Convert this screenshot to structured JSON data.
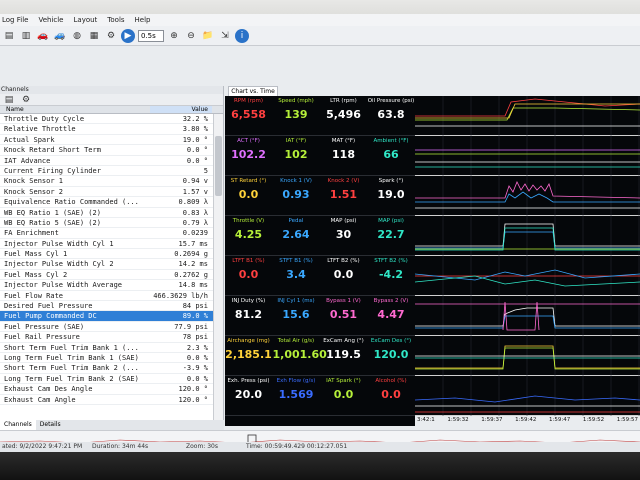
{
  "menu": [
    "Log File",
    "Vehicle",
    "Layout",
    "Tools",
    "Help"
  ],
  "toolbar": {
    "zoom_select": "0.5s"
  },
  "left_panel": {
    "title": "Channels",
    "columns": {
      "name": "Name",
      "value": "Value"
    },
    "rows": [
      {
        "name": "Throttle Duty Cycle",
        "value": "32.2 %"
      },
      {
        "name": "Relative Throttle",
        "value": "3.80 %"
      },
      {
        "name": "Actual Spark",
        "value": "19.0 °"
      },
      {
        "name": "Knock Retard Short Term",
        "value": "0.0 °"
      },
      {
        "name": "IAT Advance",
        "value": "0.0 °"
      },
      {
        "name": "Current Firing Cylinder",
        "value": "5"
      },
      {
        "name": "Knock Sensor 1",
        "value": "0.94 v"
      },
      {
        "name": "Knock Sensor 2",
        "value": "1.57 v"
      },
      {
        "name": "Equivalence Ratio Commanded (...",
        "value": "0.809 λ"
      },
      {
        "name": "WB EQ Ratio 1 (SAE) (2)",
        "value": "0.83 λ"
      },
      {
        "name": "WB EQ Ratio 5 (SAE) (2)",
        "value": "0.79 λ"
      },
      {
        "name": "FA Enrichment",
        "value": "0.0239"
      },
      {
        "name": "Injector Pulse Width Cyl 1",
        "value": "15.7 ms"
      },
      {
        "name": "Fuel Mass Cyl 1",
        "value": "0.2694 g"
      },
      {
        "name": "Injector Pulse Width Cyl 2",
        "value": "14.2 ms"
      },
      {
        "name": "Fuel Mass Cyl 2",
        "value": "0.2762 g"
      },
      {
        "name": "Injector Pulse Width Average",
        "value": "14.8 ms"
      },
      {
        "name": "Fuel Flow Rate",
        "value": "466.3629 lb/h"
      },
      {
        "name": "Desired Fuel Pressure",
        "value": "84 psi"
      },
      {
        "name": "Fuel Pump Commanded DC",
        "value": "89.0 %",
        "selected": true
      },
      {
        "name": "Fuel Pressure (SAE)",
        "value": "77.9 psi"
      },
      {
        "name": "Fuel Rail Pressure",
        "value": "78 psi"
      },
      {
        "name": "Short Term Fuel Trim Bank 1 (...",
        "value": "2.3 %"
      },
      {
        "name": "Long Term Fuel Trim Bank 1 (SAE)",
        "value": "0.0 %"
      },
      {
        "name": "Short Term Fuel Trim Bank 2 (...",
        "value": "-3.9 %"
      },
      {
        "name": "Long Term Fuel Trim Bank 2 (SAE)",
        "value": "0.0 %"
      },
      {
        "name": "Exhaust Cam Des Angle",
        "value": "120.0 °"
      },
      {
        "name": "Exhaust Cam Angle",
        "value": "120.0 °"
      }
    ],
    "tabs": [
      "Channels",
      "Details"
    ]
  },
  "chart_tab": "Chart vs. Time",
  "gauges": [
    [
      {
        "label": "RPM (rpm)",
        "value": "6,558",
        "color": "#ff4040"
      },
      {
        "label": "Speed (mph)",
        "value": "139",
        "color": "#b6f03a"
      },
      {
        "label": "LTR (rpm)",
        "value": "5,496",
        "color": "#ffffff"
      },
      {
        "label": "Oil Pressure (psi)",
        "value": "63.8",
        "color": "#ffffff"
      }
    ],
    [
      {
        "label": "ACT (°F)",
        "value": "102.2",
        "color": "#e070ff"
      },
      {
        "label": "IAT (°F)",
        "value": "102",
        "color": "#b6f03a"
      },
      {
        "label": "MAT (°F)",
        "value": "118",
        "color": "#ffffff"
      },
      {
        "label": "Ambient (°F)",
        "value": "66",
        "color": "#30e8c8"
      }
    ],
    [
      {
        "label": "ST Retard (°)",
        "value": "0.0",
        "color": "#ffd23a"
      },
      {
        "label": "Knock 1 (V)",
        "value": "0.93",
        "color": "#3aa8ff"
      },
      {
        "label": "Knock 2 (V)",
        "value": "1.51",
        "color": "#ff4040"
      },
      {
        "label": "Spark (°)",
        "value": "19.0",
        "color": "#ffffff"
      }
    ],
    [
      {
        "label": "Throttle (V)",
        "value": "4.25",
        "color": "#b6f03a"
      },
      {
        "label": "Pedal",
        "value": "2.64",
        "color": "#3aa8ff"
      },
      {
        "label": "MAP (psi)",
        "value": "30",
        "color": "#ffffff"
      },
      {
        "label": "MAP (psi)",
        "value": "22.7",
        "color": "#30e8c8"
      }
    ],
    [
      {
        "label": "LTFT B1 (%)",
        "value": "0.0",
        "color": "#ff4040"
      },
      {
        "label": "STFT B1 (%)",
        "value": "3.4",
        "color": "#3aa8ff"
      },
      {
        "label": "LTFT B2 (%)",
        "value": "0.0",
        "color": "#ffffff"
      },
      {
        "label": "STFT B2 (%)",
        "value": "-4.2",
        "color": "#30e8c8"
      }
    ],
    [
      {
        "label": "INJ Duty (%)",
        "value": "81.2",
        "color": "#ffffff"
      },
      {
        "label": "INJ Cyl 1 (ms)",
        "value": "15.6",
        "color": "#3aa8ff"
      },
      {
        "label": "Bypass 1 (V)",
        "value": "0.51",
        "color": "#ff6ad0"
      },
      {
        "label": "Bypass 2 (V)",
        "value": "4.47",
        "color": "#ff6ad0"
      }
    ],
    [
      {
        "label": "Airchange (mg)",
        "value": "2,185.1",
        "color": "#ffd23a"
      },
      {
        "label": "Total Air (g/s)",
        "value": "1,001.60",
        "color": "#b6f03a"
      },
      {
        "label": "ExCam Ang (°)",
        "value": "119.5",
        "color": "#ffffff"
      },
      {
        "label": "ExCam Des (°)",
        "value": "120.0",
        "color": "#30e8c8"
      }
    ],
    [
      {
        "label": "Exh. Press (psi)",
        "value": "20.0",
        "color": "#ffffff"
      },
      {
        "label": "Exh Flow (g/s)",
        "value": "1.569",
        "color": "#3a6cff"
      },
      {
        "label": "IAT Spark (°)",
        "value": "0.0",
        "color": "#b6f03a"
      },
      {
        "label": "Alcohol (%)",
        "value": "0.0",
        "color": "#ff4040"
      }
    ]
  ],
  "time_axis": [
    "3:42:1",
    "1:59:32",
    "1:59:37",
    "1:59:42",
    "1:59:47",
    "1:59:52",
    "1:59:57"
  ],
  "status": {
    "created": "ated: 9/2/2022 9:47:21 PM",
    "duration": "Duration: 34m 44s",
    "zoom": "Zoom: 30s",
    "time": "Time: 00:59:49.429  00:12:27.051"
  }
}
